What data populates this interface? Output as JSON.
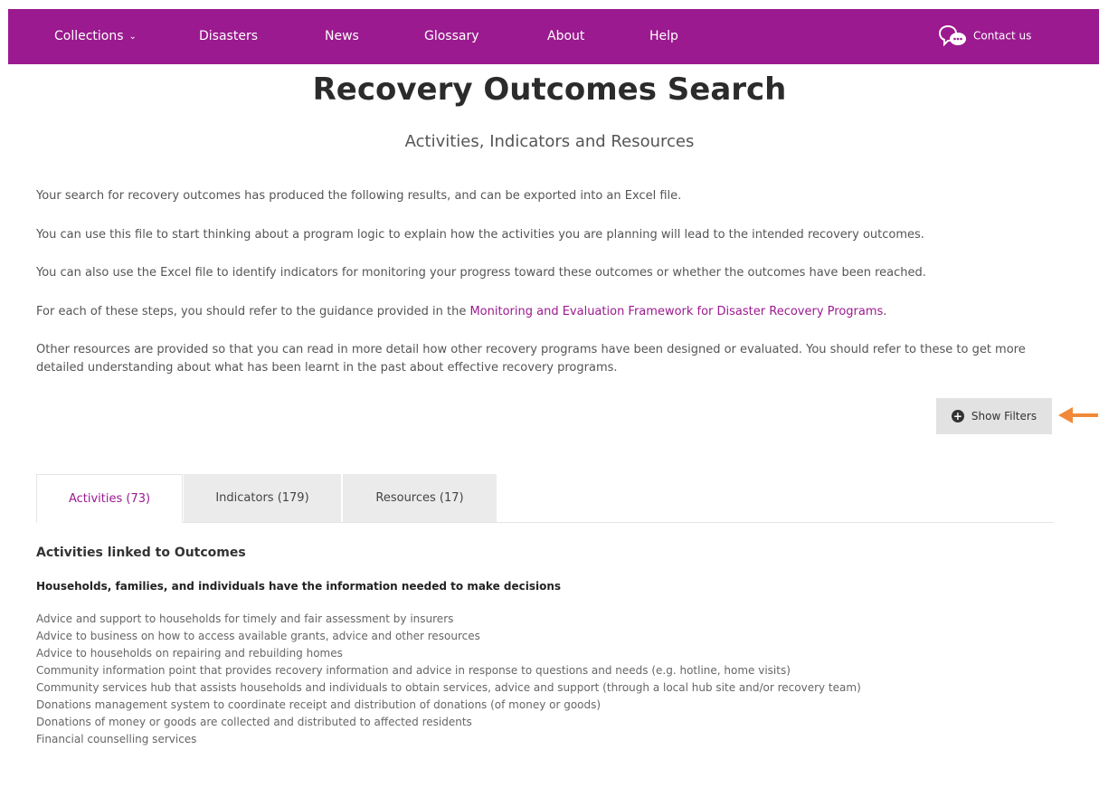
{
  "nav": {
    "items": [
      "Collections",
      "Disasters",
      "News",
      "Glossary",
      "About",
      "Help"
    ],
    "collections_caret": "⌄",
    "contact_label": "Contact us",
    "contact_icon": "chat-bubbles-icon"
  },
  "header": {
    "title": "Recovery Outcomes Search",
    "subtitle": "Activities, Indicators and Resources"
  },
  "intro": {
    "p1": "Your search for recovery outcomes has produced the following results, and can be exported into an Excel file.",
    "p2": "You can use this file to start thinking about a program logic to explain how the activities you are planning will lead to the intended recovery outcomes.",
    "p3": "You can also use the Excel file to identify indicators for monitoring your progress toward these outcomes or whether the outcomes have been reached.",
    "p4_before": "For each of these steps, you should refer to the guidance provided in the ",
    "p4_link": "Monitoring and Evaluation Framework for Disaster Recovery Programs",
    "p4_after": ".",
    "p5": "Other resources are provided so that you can read in more detail how other recovery programs have been designed or evaluated. You should refer to these to get more detailed understanding about what has been learnt in the past about effective recovery programs."
  },
  "filters": {
    "label": "Show Filters",
    "icon": "plus-circle-icon"
  },
  "tabs": [
    {
      "label": "Activities (73)",
      "active": true
    },
    {
      "label": "Indicators (179)",
      "active": false
    },
    {
      "label": "Resources (17)",
      "active": false
    }
  ],
  "content": {
    "section_heading": "Activities linked to Outcomes",
    "outcome_heading": "Households, families, and individuals have the information needed to make decisions",
    "activities": [
      "Advice and support to households for timely and fair assessment by insurers",
      "Advice to business on how to access available grants, advice and other resources",
      "Advice to households on repairing and rebuilding homes",
      "Community information point that provides recovery information and advice in response to questions and needs (e.g. hotline, home visits)",
      "Community services hub that assists households and individuals to obtain services, advice and support (through a local hub site and/or recovery team)",
      "Donations management system to coordinate receipt and distribution of donations (of money or goods)",
      "Donations of money or goods are collected and distributed to affected residents",
      "Financial counselling services"
    ]
  },
  "colors": {
    "brand_purple": "#9b1a8f",
    "annotation_arrow": "#f08a3a",
    "tab_inactive_bg": "#ebebeb",
    "button_bg": "#e2e2e2"
  }
}
